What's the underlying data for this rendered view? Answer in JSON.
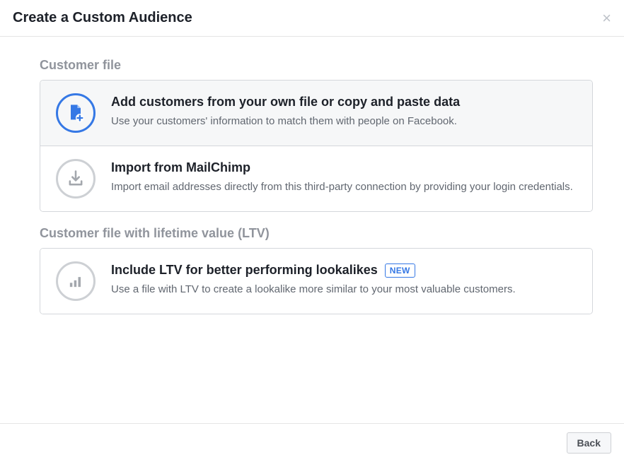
{
  "header": {
    "title": "Create a Custom Audience"
  },
  "sections": {
    "customer_file": {
      "label": "Customer file",
      "option_add": {
        "title": "Add customers from your own file or copy and paste data",
        "desc": "Use your customers' information to match them with people on Facebook."
      },
      "option_mailchimp": {
        "title": "Import from MailChimp",
        "desc": "Import email addresses directly from this third-party connection by providing your login credentials."
      }
    },
    "ltv": {
      "label": "Customer file with lifetime value (LTV)",
      "option_ltv": {
        "title": "Include LTV for better performing lookalikes",
        "badge": "NEW",
        "desc": "Use a file with LTV to create a lookalike more similar to your most valuable customers."
      }
    }
  },
  "footer": {
    "back": "Back"
  }
}
